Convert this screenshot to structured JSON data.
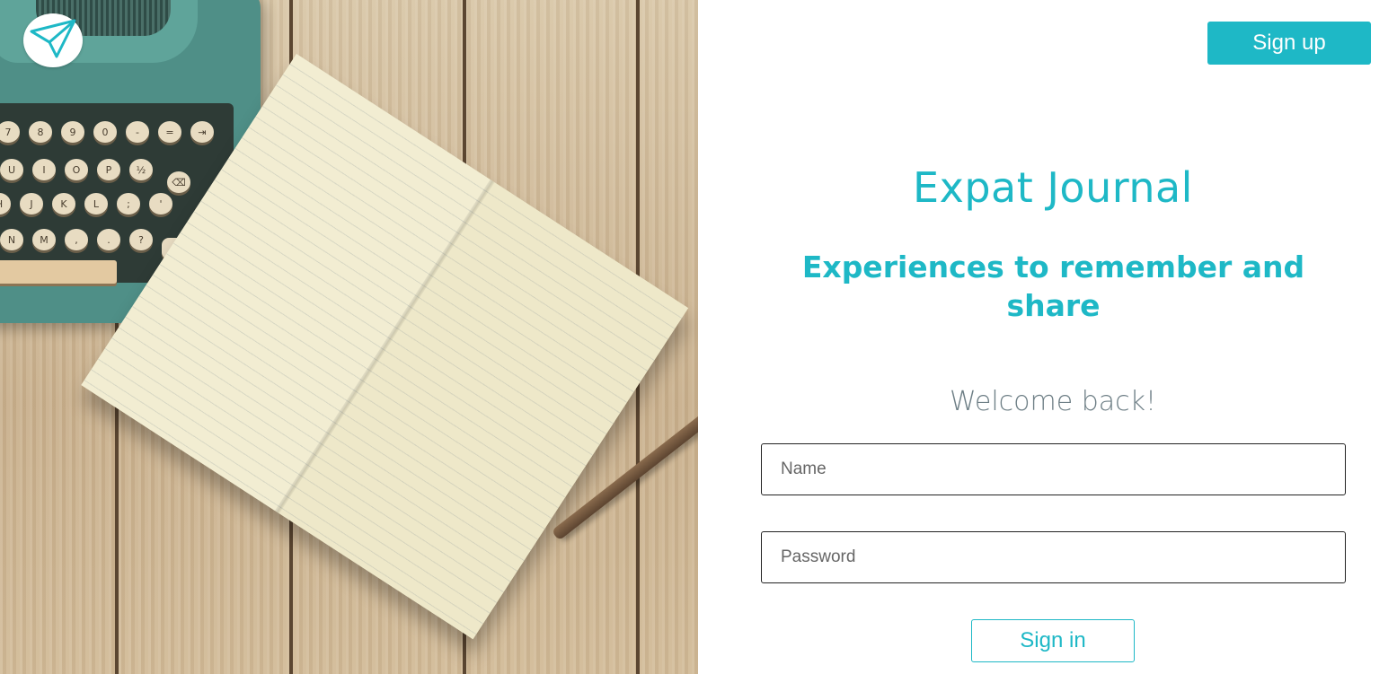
{
  "brand": {
    "logo_icon": "paper-plane-icon",
    "accent_color": "#1eb8c6"
  },
  "hero_image": {
    "subject": "typewriter-and-open-notebook-on-wooden-desk"
  },
  "header": {
    "signup_label": "Sign up"
  },
  "main": {
    "title": "Expat Journal",
    "tagline": "Experiences to remember and share",
    "welcome": "Welcome back!"
  },
  "form": {
    "name_placeholder": "Name",
    "password_placeholder": "Password",
    "signin_label": "Sign in"
  }
}
